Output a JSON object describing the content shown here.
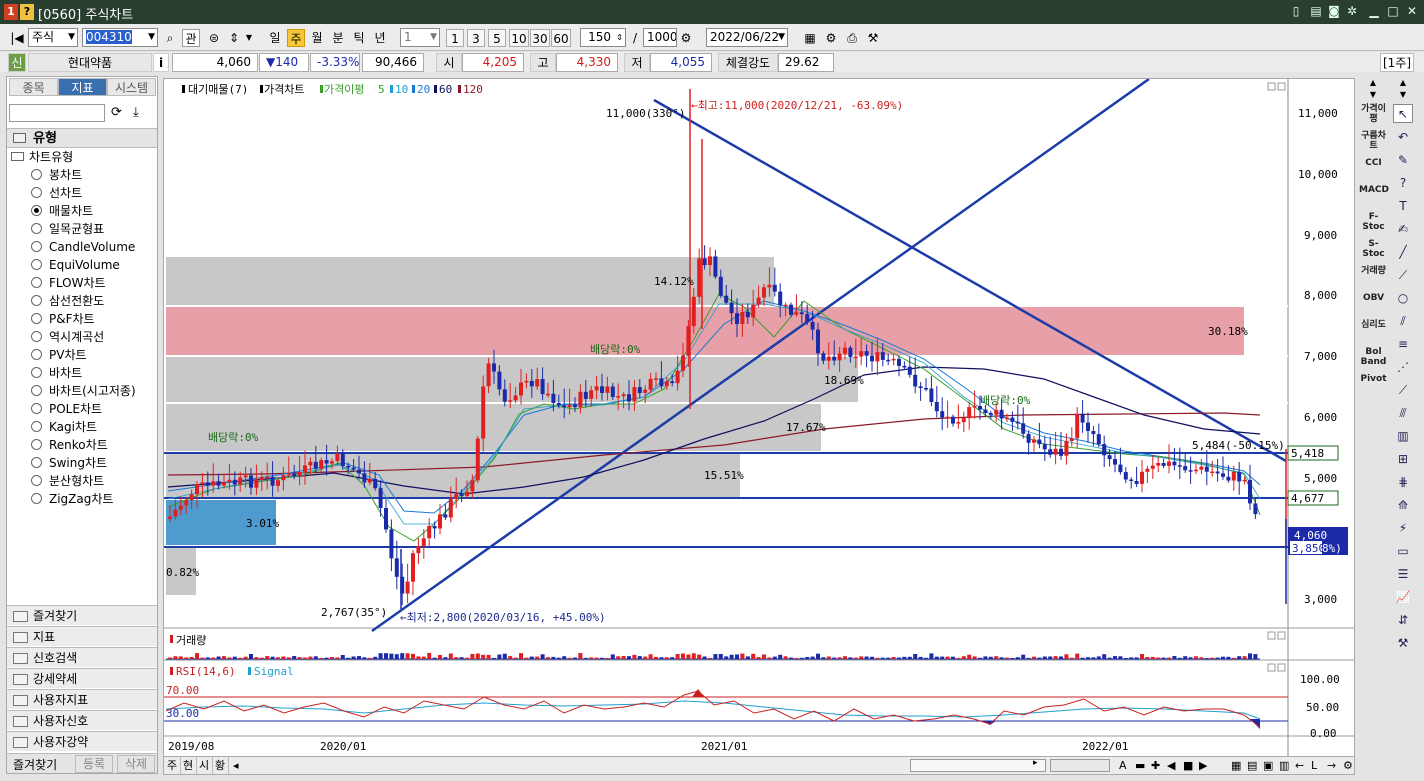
{
  "window": {
    "badge": "1",
    "help": "?",
    "title": "[0560] 주식차트"
  },
  "toolbar": {
    "market": "주식",
    "code": "004310",
    "btn_gwan": "관",
    "periods": [
      "일",
      "주",
      "월",
      "분",
      "틱",
      "년"
    ],
    "interval": "1",
    "quick": [
      "1",
      "3",
      "5",
      "10",
      "30",
      "60"
    ],
    "count": "150",
    "slash": "/",
    "total": "1000",
    "date": "2022/06/22"
  },
  "quote": {
    "badge": "신",
    "name": "현대약품",
    "info": "i",
    "price": "4,060",
    "change": "▼140",
    "rate": "-3.33%",
    "volume": "90,466",
    "open_label": "시",
    "open": "4,205",
    "high_label": "고",
    "high": "4,330",
    "low_label": "저",
    "low": "4,055",
    "strength_label": "체결강도",
    "strength": "29.62",
    "week": "[1주]"
  },
  "left_panel": {
    "tabs": [
      "종목",
      "지표",
      "시스템"
    ],
    "section": "유형",
    "tree_root": "차트유형",
    "chart_types": [
      "봉차트",
      "선차트",
      "매물차트",
      "일목균형표",
      "CandleVolume",
      "EquiVolume",
      "FLOW차트",
      "삼선전환도",
      "P&F차트",
      "역시계곡선",
      "PV차트",
      "바차트",
      "바차트(시고저종)",
      "POLE차트",
      "Kagi차트",
      "Renko차트",
      "Swing차트",
      "분산형차트",
      "ZigZag차트"
    ],
    "selected_index": 2,
    "folders": [
      "즐겨찾기",
      "지표",
      "신호검색",
      "강세약세",
      "사용자지표",
      "사용자신호",
      "사용자강약"
    ],
    "footer": [
      "즐겨찾기",
      "등록",
      "삭제"
    ]
  },
  "price_pane": {
    "legend": [
      "대기매물(7)",
      "가격차트",
      "가격이평",
      "5",
      "10",
      "20",
      "60",
      "120"
    ],
    "y_ticks": [
      "11,000",
      "10,000",
      "9,000",
      "8,000",
      "7,000",
      "6,000",
      "5,000",
      "3,000"
    ],
    "annotations": {
      "high_mark": "11,000(330°)",
      "high_note": "←최고:11,000(2020/12/21, -63.09%)",
      "low_mark": "2,767(35°)",
      "low_note": "←최저:2,800(2020/03/16, +45.00%)",
      "pct_1412": "14.12%",
      "pct_3018": "30.18%",
      "pct_1869": "18.69%",
      "pct_1767": "17.67%",
      "pct_1551": "15.51%",
      "pct_301": "3.01%",
      "pct_082": "0.82%",
      "div_1": "배당락:0%",
      "div_2": "배당락:0%",
      "div_3": "배당락:0%",
      "ref_note": "5,484(-50.15%)"
    },
    "axis_tags": {
      "t1": "5,418",
      "t2": "4,677",
      "t3": "4,060",
      "t4": "3,850",
      "t4_suffix": "8%)"
    }
  },
  "volume_pane": {
    "legend": "거래량"
  },
  "rsi_pane": {
    "legend": [
      "RSI(14,6)",
      "Signal"
    ],
    "levels": [
      "70.00",
      "30.00"
    ],
    "y_ticks": [
      "100.00",
      "50.00",
      "0.00"
    ]
  },
  "x_ticks": [
    "2019/08",
    "2020/01",
    "2021/01",
    "2022/01"
  ],
  "indicator_bar": [
    "가격이평",
    "구름차트",
    "CCI",
    "MACD",
    "F-Stoc",
    "S-Stoc",
    "거래량",
    "OBV",
    "심리도",
    "Bol Band",
    "Pivot"
  ],
  "bottom_tabs": [
    "주",
    "현",
    "시",
    "황"
  ],
  "colors": {
    "up": "#e02020",
    "down": "#1a2aa8",
    "line_blue": "#1c3ca8",
    "pink_zone": "#e8a0a8",
    "gray_zone": "#c8c8c8",
    "blue_zone": "#4f9bd0"
  }
}
